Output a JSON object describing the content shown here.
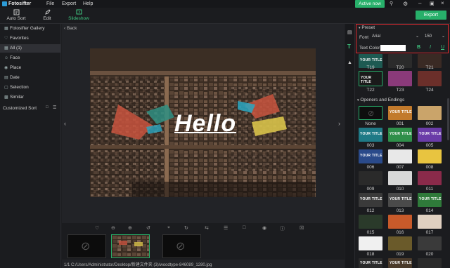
{
  "app": {
    "title": "Fotosifter"
  },
  "menu": {
    "file": "File",
    "export": "Export",
    "help": "Help"
  },
  "titlebar": {
    "active_now": "Active now"
  },
  "toolbar": {
    "auto_sort": "Auto Sort",
    "edit": "Edit",
    "slideshow": "Slideshow",
    "export_btn": "Export"
  },
  "nav": {
    "back": "Back"
  },
  "sidebar": {
    "gallery": "Fotosifter Gallery",
    "favorites": "Favorites",
    "all": "All (1)",
    "face": "Face",
    "place": "Place",
    "date": "Date",
    "selection": "Selection",
    "similar": "Similar",
    "customized_sort": "Customized Sort"
  },
  "canvas": {
    "overlay_text": "Hello"
  },
  "status": {
    "path": "1/1  C:/Users/Administrator/Desktop/新建文件夹 (3)/woodtype-846089_1280.jpg"
  },
  "preset": {
    "header": "Preset",
    "font_label": "Font",
    "font_value": "Arial",
    "size_value": "150",
    "text_color_label": "Text Color",
    "bold": "B",
    "italic": "I",
    "underline": "U"
  },
  "titles": {
    "tile_text": "YOUR TITLE",
    "row1": [
      "T19",
      "T20",
      "T21"
    ],
    "row2": [
      "T22",
      "T23",
      "T24"
    ]
  },
  "openers": {
    "header": "Openers and Endings",
    "labels": [
      "None",
      "001",
      "002",
      "003",
      "004",
      "005",
      "006",
      "007",
      "008",
      "009",
      "010",
      "011",
      "012",
      "013",
      "014",
      "015",
      "016",
      "017",
      "018",
      "019",
      "020"
    ]
  }
}
